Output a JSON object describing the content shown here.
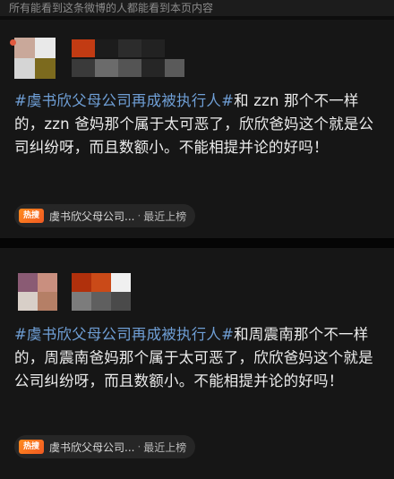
{
  "notice_text": "所有能看到这条微博的人都能看到本页内容",
  "colors": {
    "background": "#0d0d0d",
    "card": "#161616",
    "hashtag": "#6f9fd6",
    "hot_badge": "#f15a22"
  },
  "posts": [
    {
      "avatar_redacted": true,
      "username_redacted": true,
      "hashtag": "#虞书欣父母公司再成被执行人#",
      "body": "和 zzn 那个不一样的，zzn 爸妈那个属于太可恶了，欣欣爸妈这个就是公司纠纷呀，而且数额小。不能相提并论的好吗！",
      "topic_pill": {
        "badge": "热搜",
        "topic": "虞书欣父母公司...",
        "separator": "·",
        "status": "最近上榜"
      }
    },
    {
      "avatar_redacted": true,
      "username_redacted": true,
      "hashtag": "#虞书欣父母公司再成被执行人#",
      "body": "和周震南那个不一样的，周震南爸妈那个属于太可恶了，欣欣爸妈这个就是公司纠纷呀，而且数额小。不能相提并论的好吗！",
      "topic_pill": {
        "badge": "热搜",
        "topic": "虞书欣父母公司...",
        "separator": "·",
        "status": "最近上榜"
      }
    }
  ]
}
